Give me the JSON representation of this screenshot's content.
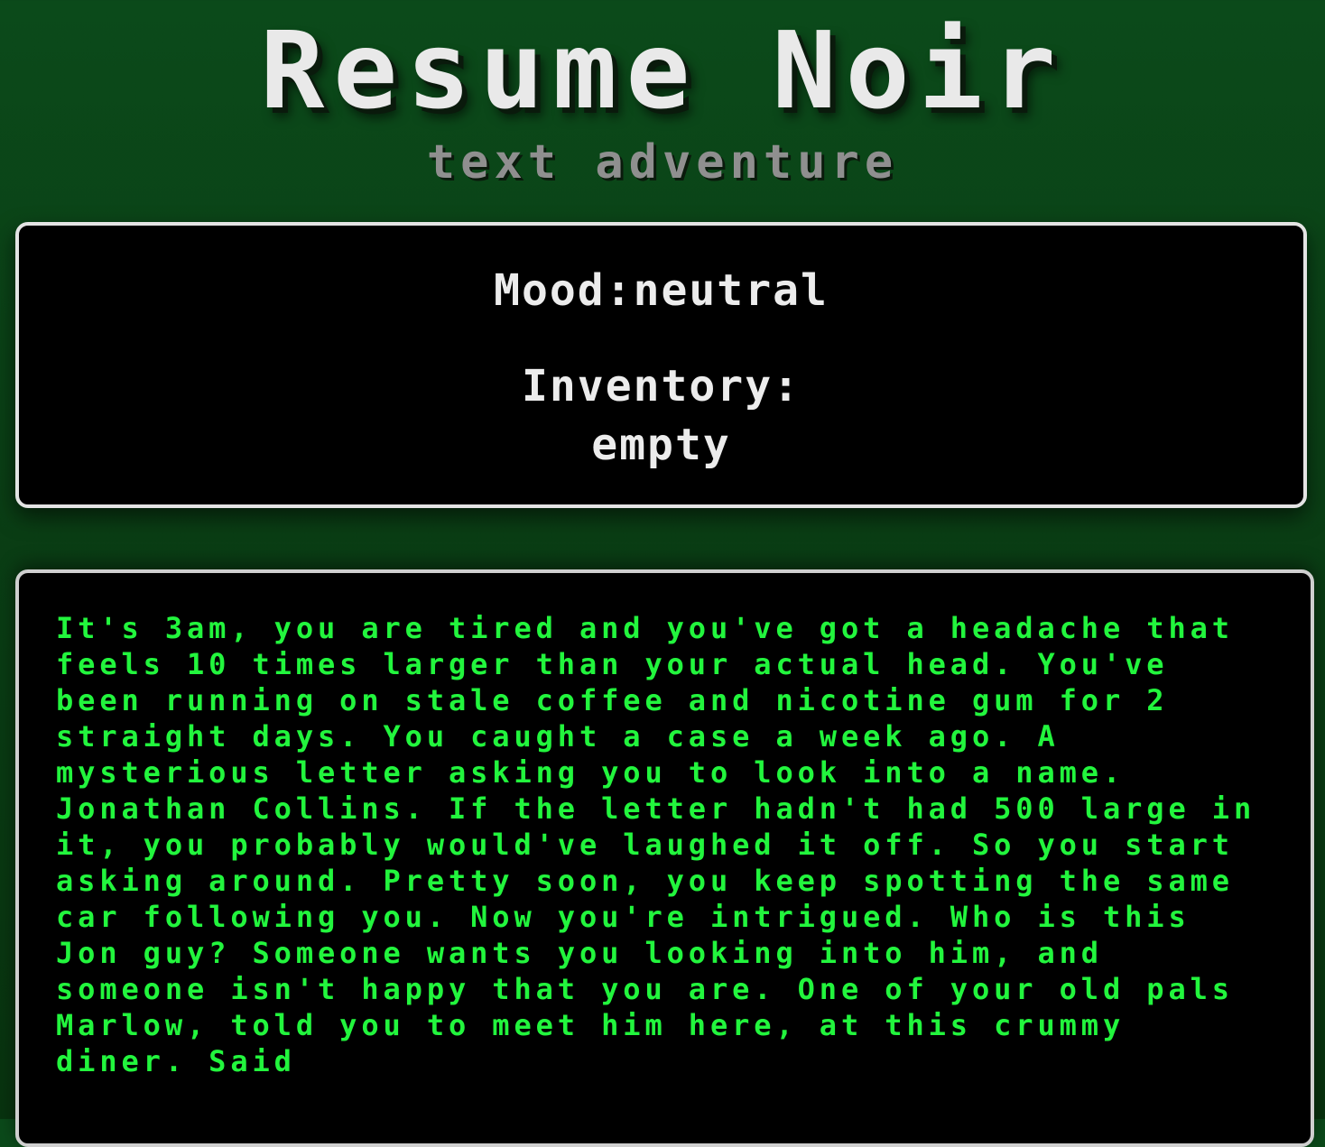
{
  "header": {
    "title": "Resume Noir",
    "subtitle": "text adventure"
  },
  "status": {
    "mood_label": "Mood:",
    "mood_value": "neutral",
    "inventory_label": "Inventory:",
    "inventory_value": "empty"
  },
  "story": {
    "text": "It's 3am, you are tired and you've got a headache that feels 10 times larger than your actual head. You've been running on stale coffee and nicotine gum for 2 straight days. You caught a case a week ago. A mysterious letter asking you to look into a name. Jonathan Collins. If the letter hadn't had 500 large in it, you probably would've laughed it off. So you start asking around. Pretty soon, you keep spotting the same car following you. Now you're intrigued. Who is this Jon guy? Someone wants you looking into him, and someone isn't happy that you are. One of your old pals Marlow, told you to meet him here, at this crummy diner. Said"
  },
  "colors": {
    "background": "#0b4a1a",
    "panel": "#000000",
    "story_text": "#22f53d",
    "title_text": "#e9e9e9",
    "subtitle_text": "#8f8f8f"
  }
}
